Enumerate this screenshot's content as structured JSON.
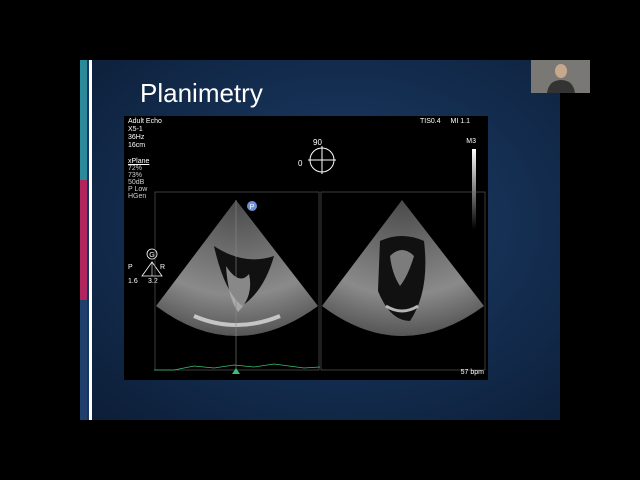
{
  "slide": {
    "title": "Planimetry",
    "accent_colors": {
      "teal": "#2a8a99",
      "pink": "#b0265c",
      "navy": "#1f3f6d"
    }
  },
  "echo": {
    "mode": "Adult Echo",
    "probe": "X5-1",
    "frequency": "36Hz",
    "depth": "16cm",
    "tis": "TIS0.4",
    "mi": "MI 1.1",
    "xplane_header": "xPlane",
    "xplane_settings": [
      "72%",
      "73%",
      "50dB",
      "P Low",
      "HGen"
    ],
    "orientation_angle": "90",
    "orientation_zero": "0",
    "colormap": "M3",
    "probe_marker": "G",
    "probe_left": "P",
    "probe_right": "R",
    "value_left": "1.6",
    "value_right": "3.2",
    "heart_rate": "57 bpm",
    "image_markers": [
      "P"
    ]
  },
  "webcam": {
    "icon": "person-icon"
  }
}
